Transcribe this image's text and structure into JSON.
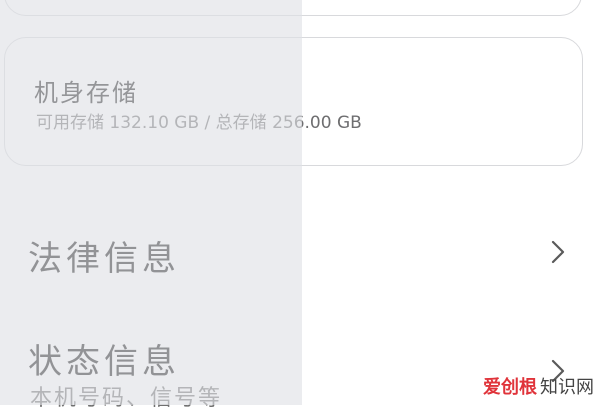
{
  "storage": {
    "title": "机身存储",
    "detail": "可用存储 132.10 GB / 总存储 256.00 GB"
  },
  "rows": [
    {
      "title": "法律信息",
      "subtitle": ""
    },
    {
      "title": "状态信息",
      "subtitle": "本机号码、信号等"
    }
  ],
  "icons": {
    "row_arrow": "chevron-right-icon"
  },
  "watermark": {
    "part_a": "爱创根",
    "part_b": "知识网"
  },
  "colors": {
    "background": "#ffffff",
    "card_border": "#d8d9dc",
    "title_text": "#151515",
    "secondary_text": "#6e6e70",
    "chevron": "#5a5a5a",
    "watermark_accent": "#e0343b"
  }
}
